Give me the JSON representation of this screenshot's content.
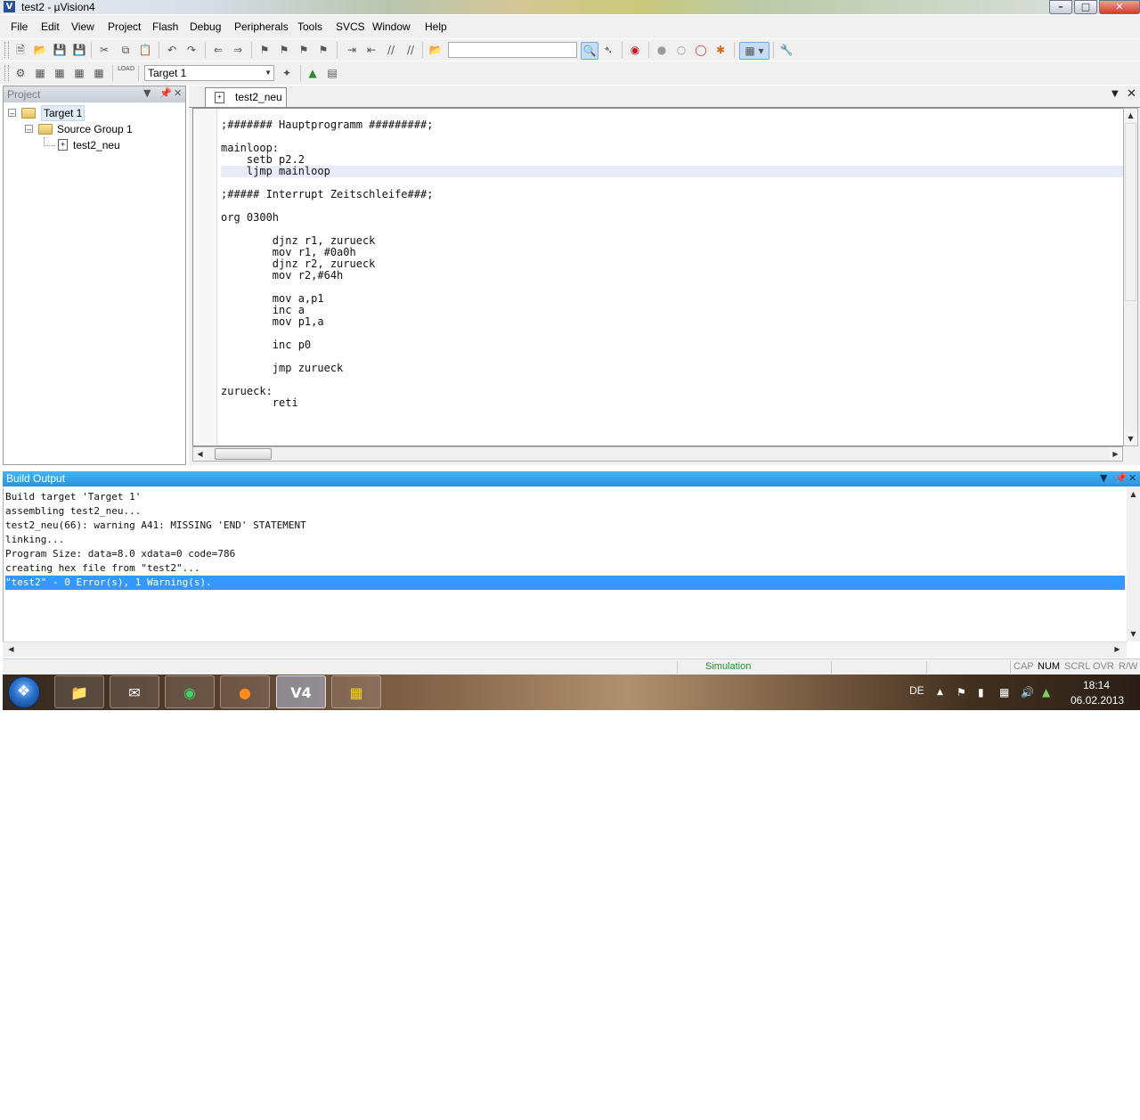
{
  "window": {
    "title": "test2  - µVision4",
    "app_icon": "uv4-app-icon"
  },
  "menu": [
    {
      "label": "File",
      "name": "menu-file"
    },
    {
      "label": "Edit",
      "name": "menu-edit"
    },
    {
      "label": "View",
      "name": "menu-view"
    },
    {
      "label": "Project",
      "name": "menu-project"
    },
    {
      "label": "Flash",
      "name": "menu-flash"
    },
    {
      "label": "Debug",
      "name": "menu-debug"
    },
    {
      "label": "Peripherals",
      "name": "menu-peripherals"
    },
    {
      "label": "Tools",
      "name": "menu-tools"
    },
    {
      "label": "SVCS",
      "name": "menu-svcs"
    },
    {
      "label": "Window",
      "name": "menu-window"
    },
    {
      "label": "Help",
      "name": "menu-help"
    }
  ],
  "toolbar": {
    "find_combo_value": "",
    "target_select": "Target 1"
  },
  "project_panel": {
    "title": "Project",
    "tree": {
      "target": "Target 1",
      "group": "Source Group 1",
      "file": "test2_neu"
    }
  },
  "editor": {
    "active_tab": "test2_neu",
    "current_line_index": 4,
    "lines": [
      ";####### Hauptprogramm #########;",
      "",
      "mainloop:",
      "    setb p2.2",
      "    ljmp mainloop",
      "",
      ";##### Interrupt Zeitschleife###;",
      "",
      "org 0300h",
      "",
      "        djnz r1, zurueck",
      "        mov r1, #0a0h",
      "        djnz r2, zurueck",
      "        mov r2,#64h",
      "",
      "        mov a,p1",
      "        inc a",
      "        mov p1,a",
      "",
      "        inc p0",
      "",
      "        jmp zurueck",
      "",
      "zurueck:",
      "        reti"
    ]
  },
  "build_output": {
    "title": "Build Output",
    "selected_index": 6,
    "lines": [
      "Build target 'Target 1'",
      "assembling test2_neu...",
      "test2_neu(66): warning A41: MISSING 'END' STATEMENT",
      "linking...",
      "Program Size: data=8.0 xdata=0 code=786",
      "creating hex file from \"test2\"...",
      "\"test2\" - 0 Error(s), 1 Warning(s)."
    ]
  },
  "status_bar": {
    "mode": "Simulation",
    "mode_color": "#2e8b2e",
    "indicators": [
      "CAP",
      "NUM",
      "SCRL",
      "OVR",
      "R/W"
    ]
  },
  "taskbar": {
    "language": "DE",
    "time": "18:14",
    "date": "06.02.2013"
  }
}
